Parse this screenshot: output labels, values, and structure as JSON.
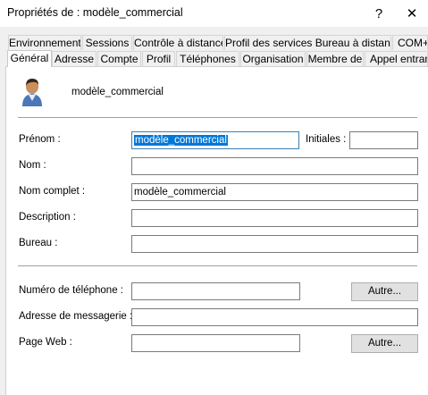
{
  "window": {
    "title": "Propriétés de : modèle_commercial",
    "help_glyph": "?",
    "close_glyph": "✕"
  },
  "tabs_back": [
    "Environnement",
    "Sessions",
    "Contrôle à distance",
    "Profil des services Bureau à distance",
    "COM+"
  ],
  "tabs_front": [
    "Général",
    "Adresse",
    "Compte",
    "Profil",
    "Téléphones",
    "Organisation",
    "Membre de",
    "Appel entrant"
  ],
  "active_tab": "Général",
  "user": {
    "display_name": "modèle_commercial",
    "icon": "user-icon"
  },
  "fields": {
    "prenom": {
      "label": "Prénom :",
      "value": "modèle_commercial"
    },
    "initiales": {
      "label": "Initiales :",
      "value": ""
    },
    "nom": {
      "label": "Nom :",
      "value": ""
    },
    "nom_complet": {
      "label": "Nom complet :",
      "value": "modèle_commercial"
    },
    "description": {
      "label": "Description :",
      "value": ""
    },
    "bureau": {
      "label": "Bureau :",
      "value": ""
    },
    "telephone": {
      "label": "Numéro de téléphone :",
      "value": "",
      "button": "Autre..."
    },
    "messagerie": {
      "label": "Adresse de messagerie :",
      "value": ""
    },
    "page_web": {
      "label": "Page Web :",
      "value": "",
      "button": "Autre..."
    }
  },
  "colors": {
    "selection": "#0078d7",
    "background": "#f0f0f0",
    "panel": "#ffffff"
  }
}
